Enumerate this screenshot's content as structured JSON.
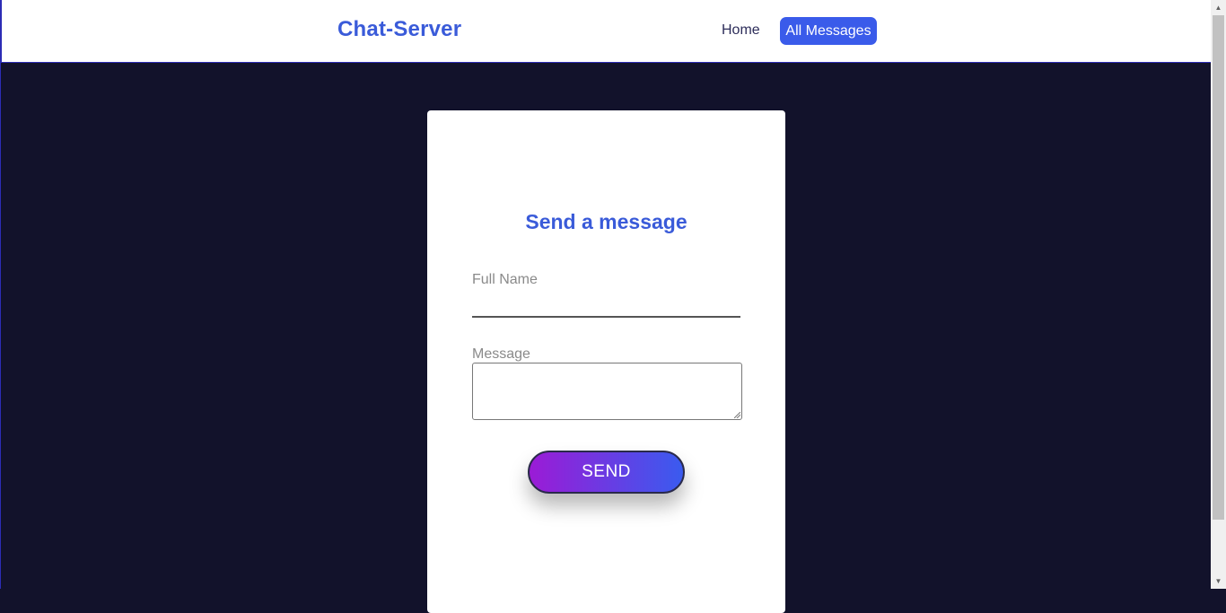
{
  "navbar": {
    "brand": "Chat-Server",
    "links": [
      {
        "label": "Home"
      },
      {
        "label": "All Messages",
        "active": true
      }
    ]
  },
  "form": {
    "title": "Send a message",
    "name_label": "Full Name",
    "name_value": "",
    "message_label": "Message",
    "message_value": "",
    "submit_label": "SEND"
  },
  "colors": {
    "brand": "#3a5bd9",
    "active_link_bg": "#3a5bea",
    "page_bg": "#12122b",
    "button_gradient_start": "#9b1bd6",
    "button_gradient_end": "#3a5bef"
  },
  "icons": {
    "scroll_up": "triangle-up-icon",
    "scroll_down": "triangle-down-icon",
    "resize": "resize-grip-icon"
  }
}
